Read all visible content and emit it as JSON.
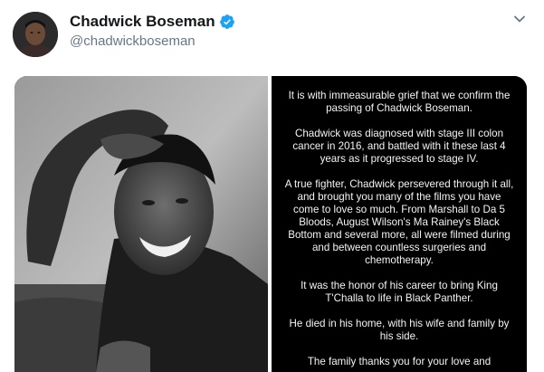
{
  "tweet": {
    "author": {
      "name": "Chadwick Boseman",
      "handle": "@chadwickboseman",
      "verified": true
    },
    "menu_icon": "chevron-down-icon",
    "media": {
      "photo": "portrait-photo",
      "statement": [
        "It is with immeasurable grief that we confirm the passing of Chadwick Boseman.",
        "Chadwick was diagnosed with stage III colon cancer in 2016, and battled with it these last 4 years as it progressed to stage IV.",
        "A true fighter, Chadwick persevered through it all, and brought you many of the films you have come to love so much. From Marshall to Da 5 Bloods, August Wilson's Ma Rainey's Black Bottom and several more, all were filmed during and between countless surgeries and chemotherapy.",
        "It was the honor of his career to bring King T'Challa to life in Black Panther.",
        "He died in his home, with his wife and family by his side.",
        "The family thanks you for your love and"
      ]
    }
  },
  "colors": {
    "verified_blue": "#1da1f2",
    "text_primary": "#14171a",
    "text_secondary": "#657786",
    "media_bg": "#000000"
  }
}
